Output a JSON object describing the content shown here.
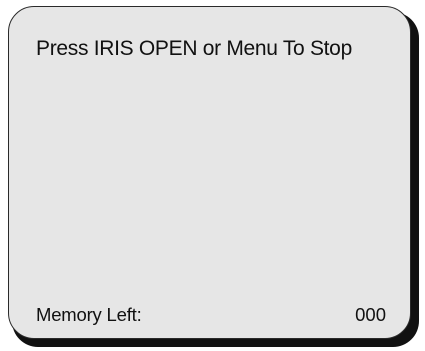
{
  "screen": {
    "prompt": "Press IRIS OPEN or Menu To Stop",
    "memory_label": "Memory Left:",
    "memory_value": "000"
  },
  "colors": {
    "panel_background": "#e6e6e6",
    "text": "#111111",
    "shadow": "#111111"
  }
}
